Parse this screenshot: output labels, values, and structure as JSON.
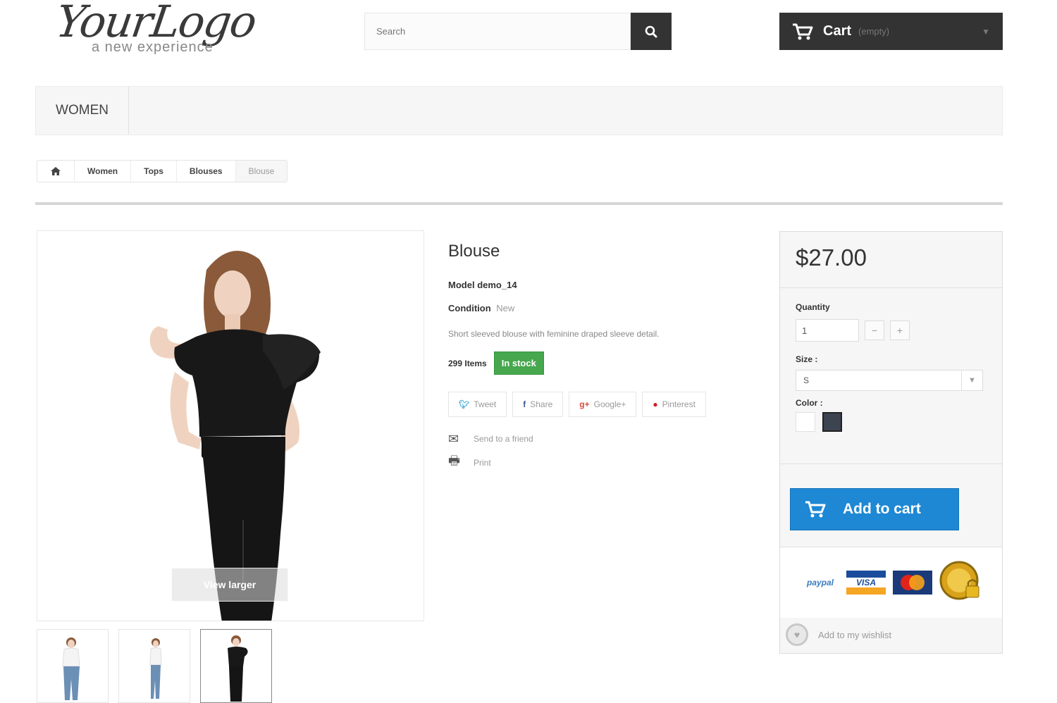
{
  "header": {
    "logo_text": "YourLogo",
    "logo_tagline": "a new experience",
    "search_placeholder": "Search",
    "cart_label": "Cart",
    "cart_status": "(empty)"
  },
  "nav": {
    "items": [
      {
        "label": "Women"
      }
    ]
  },
  "breadcrumb": {
    "items": [
      "Women",
      "Tops",
      "Blouses"
    ],
    "current": "Blouse"
  },
  "product": {
    "title": "Blouse",
    "model_label": "Model",
    "model": "demo_14",
    "condition_label": "Condition",
    "condition": "New",
    "description": "Short sleeved blouse with feminine draped sleeve detail.",
    "items_count": "299 Items",
    "stock_status": "In stock",
    "view_larger": "View larger",
    "social": [
      {
        "icon": "twitter-icon",
        "label": "Tweet"
      },
      {
        "icon": "facebook-icon",
        "label": "Share"
      },
      {
        "icon": "google-plus-icon",
        "label": "Google+"
      },
      {
        "icon": "pinterest-icon",
        "label": "Pinterest"
      }
    ],
    "send_to_friend": "Send to a friend",
    "print": "Print"
  },
  "buybox": {
    "price": "$27.00",
    "quantity_label": "Quantity",
    "quantity_value": "1",
    "size_label": "Size :",
    "size_value": "S",
    "color_label": "Color :",
    "colors": [
      "#ffffff",
      "#3c4450"
    ],
    "add_to_cart": "Add to cart",
    "payments": [
      "paypal",
      "VISA",
      "mastercard",
      "secure"
    ],
    "wishlist": "Add to my wishlist"
  },
  "colors": {
    "dark": "#333333",
    "stock_green": "#46a74e",
    "cart_blue": "#1e88d4"
  }
}
